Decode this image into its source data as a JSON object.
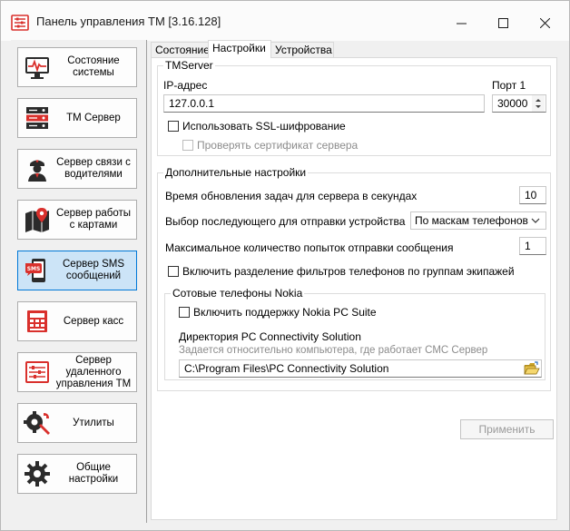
{
  "window": {
    "title": "Панель управления TM [3.16.128]"
  },
  "sidebar": {
    "items": [
      {
        "label": "Состояние системы",
        "icon": "monitor-icon",
        "active": false
      },
      {
        "label": "TM Сервер",
        "icon": "server-icon",
        "active": false
      },
      {
        "label": "Сервер связи с водителями",
        "icon": "driver-icon",
        "active": false
      },
      {
        "label": "Сервер работы с картами",
        "icon": "map-icon",
        "active": false
      },
      {
        "label": "Сервер SMS сообщений",
        "icon": "sms-icon",
        "active": true
      },
      {
        "label": "Сервер касс",
        "icon": "cash-register-icon",
        "active": false
      },
      {
        "label": "Сервер удаленного управления TM",
        "icon": "remote-control-icon",
        "active": false
      },
      {
        "label": "Утилиты",
        "icon": "tools-icon",
        "active": false
      },
      {
        "label": "Общие настройки",
        "icon": "gear-icon",
        "active": false
      }
    ]
  },
  "tabs": [
    "Состояние",
    "Настройки",
    "Устройства"
  ],
  "active_tab": "Настройки",
  "tmserver": {
    "group_title": "TMServer",
    "ip_label": "IP-адрес",
    "ip_value": "127.0.0.1",
    "port_label": "Порт 1",
    "port_value": "30000",
    "ssl_label": "Использовать SSL-шифрование",
    "verify_cert_label": "Проверять сертификат сервера"
  },
  "extra": {
    "group_title": "Дополнительные настройки",
    "refresh_label": "Время обновления задач для сервера в секундах",
    "refresh_value": "10",
    "next_device_label": "Выбор последующего для отправки устройства",
    "next_device_value": "По маскам телефонов",
    "max_attempts_label": "Максимальное количество попыток отправки сообщения",
    "max_attempts_value": "1",
    "split_filters_label": "Включить разделение фильтров телефонов по группам экипажей"
  },
  "nokia": {
    "group_title": "Сотовые телефоны Nokia",
    "enable_label": "Включить поддержку Nokia PC Suite",
    "dir_label": "Директория PC Connectivity Solution",
    "dir_hint": "Задается относительно компьютера, где работает СМС Сервер",
    "dir_value": "C:\\Program Files\\PC Connectivity Solution"
  },
  "apply_label": "Применить",
  "colors": {
    "accent": "#0078d7",
    "active_bg": "#cce4f7",
    "icon_red": "#d9302c",
    "icon_dark": "#2b2b2b"
  }
}
